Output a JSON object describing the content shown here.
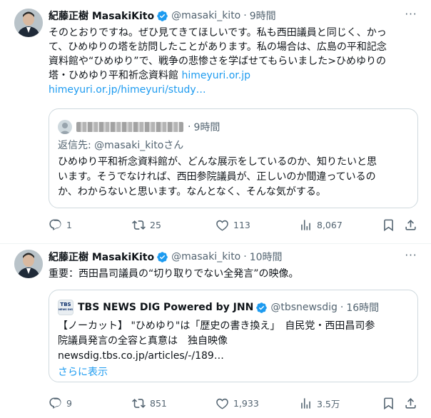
{
  "tweets": [
    {
      "author_name": "紀藤正樹 MasakiKito",
      "handle": "@masaki_kito",
      "dot": "·",
      "time": "9時間",
      "body_lines": [
        "そのとおりですね。ぜひ見てきてほしいです。私も西田議員と同じく、かっ",
        "て、ひめゆりの塔を訪問したことがあります。私の場合は、広島の平和記念",
        "資料館や“ひめゆり”で、戦争の悲惨さを学ばせてもらいました>ひめゆりの"
      ],
      "body_line4_text": "塔・ひめゆり平和祈念資料館 ",
      "body_line4_link": "himeyuri.or.jp",
      "body_line5_link": "himeyuri.or.jp/himeyuri/study…",
      "quote": {
        "time": "9時間",
        "dot": "·",
        "reply_to": "返信先: @masaki_kitoさん",
        "lines": [
          "ひめゆり平和祈念資料館が、どんな展示をしているのか、知りたいと思",
          "います。そうでなければ、西田参院議員が、正しいのか間違っているの",
          "か、わからないと思います。なんとなく、そんな気がする。"
        ]
      },
      "stats": {
        "replies": "1",
        "retweets": "25",
        "likes": "113",
        "views": "8,067"
      }
    },
    {
      "author_name": "紀藤正樹 MasakiKito",
      "handle": "@masaki_kito",
      "dot": "·",
      "time": "10時間",
      "body_lines": [
        "重要：西田昌司議員の“切り取りでない全発言”の映像。"
      ],
      "quote": {
        "author_name": "TBS NEWS DIG Powered by JNN",
        "handle": "@tbsnewsdig",
        "dot": "·",
        "time": "16時間",
        "logo_top": "TBS",
        "logo_bottom": "NEWS DIG",
        "lines": [
          "【ノーカット】 \"ひめゆり\"は「歴史の書き換え」　自民党・西田昌司参",
          "院議員発言の全容と真意は　独自映像",
          "newsdig.tbs.co.jp/articles/-/189…"
        ],
        "show_more": "さらに表示"
      },
      "stats": {
        "replies": "9",
        "retweets": "851",
        "likes": "1,933",
        "views": "3.5万"
      }
    }
  ],
  "colors": {
    "accent": "#1d9bf0",
    "muted": "#536471",
    "text": "#0f1419",
    "border": "#cfd9de"
  },
  "icons": [
    "verified-badge-icon",
    "more-icon",
    "reply-icon",
    "retweet-icon",
    "like-icon",
    "views-icon",
    "bookmark-icon",
    "share-icon"
  ]
}
